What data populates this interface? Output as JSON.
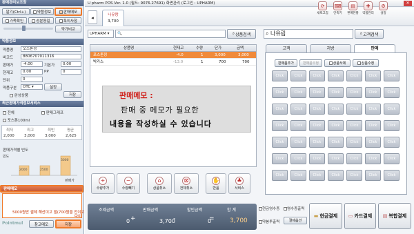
{
  "window": {
    "title": "U pharm POS Ver. 1.0 (필드: 9076.27691) 화면관리 (로그인 : UPHARM)"
  },
  "left": {
    "mgmt_header": "판매관리보조창",
    "btn_age": "알기(Ctrl+)",
    "btn_drug_info": "약품정보",
    "btn_sale_memo": "판매메모",
    "btn_family": "가족확인",
    "btn_ingredient": "성분동일",
    "btn_special": "특이사항",
    "btn_supply": "약가비교",
    "drug_header": "약품정보",
    "drug_name_label": "약품명",
    "drug_name": "포스톤정",
    "barcode_label": "바코드",
    "barcode": "8806707011316",
    "price_label": "판매가",
    "price": "-4.00",
    "base_label": "기본가",
    "base": "0.00",
    "stock_label": "현재고",
    "stock": "0.00",
    "pp_label": "PP",
    "pp": "0",
    "unit_label": "단위",
    "unit": "0",
    "cls_label": "약품구분",
    "cls": "OTC",
    "btn_setting": "설정",
    "btn_save": "저장",
    "chk_full": "완성상품",
    "sales_header": "최근판매가격정보서비스",
    "chk_all": "전체",
    "chk_box": "판매그래프",
    "item_name": "포스톤100ml",
    "stat_cols": [
      "최저",
      "최고",
      "최빈",
      "평균"
    ],
    "stat_vals": [
      "2,000",
      "3,000",
      "3,000",
      "2,625"
    ],
    "chart_header": "판매가격별 빈도",
    "chart_data": {
      "type": "bar",
      "categories": [
        "2000",
        "2500",
        "3000"
      ],
      "values": [
        1,
        1,
        2
      ],
      "xlabel": "판매가",
      "ylabel": "빈도",
      "title": ""
    },
    "memo_header": "판매메모",
    "memo_text": "5000원만 결제 해산이고 팔(700원을 전이고",
    "memo_sub": "다이",
    "brand": "Pointmul",
    "btn_ref_memo": "참고메모",
    "btn_memo_save": "저장"
  },
  "toolbar": {
    "pos_tab": "나유랑",
    "pos_amount": "3,700",
    "items": [
      "새로고침",
      "단축키",
      "판매현황",
      "약품관리",
      "설정"
    ]
  },
  "search": {
    "mode": "UPHARM",
    "placeholder": "",
    "btn_product_search": "상품검색",
    "customer_name": "나유림",
    "btn_customer_search": "고객검색"
  },
  "grid": {
    "headers": [
      "상품명",
      "현재고",
      "수량",
      "단가",
      "금액"
    ],
    "rows": [
      {
        "name": "포스톤정",
        "stock": "-4.0",
        "qty": "1",
        "price": "3,000",
        "amount": "3,000",
        "selected": true
      },
      {
        "name": "박카스",
        "stock": "-13.0",
        "qty": "1",
        "price": "700",
        "amount": "700",
        "selected": false
      }
    ]
  },
  "overlay": {
    "line1": "판매메모 :",
    "line2": "판매 중 메모가 필요한",
    "line3": "내용을 작성하실 수 있습니다"
  },
  "actions": [
    "수량추가",
    "수량빼기",
    "상품취소",
    "전체취소",
    "반품",
    "서비스"
  ],
  "right_tabs": [
    "고객",
    "처방",
    "판매"
  ],
  "right_toolbar": [
    "판매품추가",
    "판매품수정",
    "상품삭제",
    "상품수정"
  ],
  "key_label": "Click",
  "totals": {
    "sale_label": "조제금액",
    "sale_value": "0",
    "plus": "+",
    "sell_label": "판매금액",
    "sell_value": "3,700",
    "minus": "-",
    "disc_label": "할인금액",
    "disc_value": "0",
    "eq": "=",
    "total_label": "합 계",
    "total_value": "3,700"
  },
  "opts": [
    "현금영수증",
    "영수증출력",
    "약봉투출력",
    "결제옵션"
  ],
  "pay": {
    "cash": "현금결제",
    "card": "카드결제",
    "mixed": "복합결제"
  },
  "colors": {
    "accent": "#f07a2a",
    "header": "#5b6e8f",
    "selected_row": "#f08a3a"
  }
}
